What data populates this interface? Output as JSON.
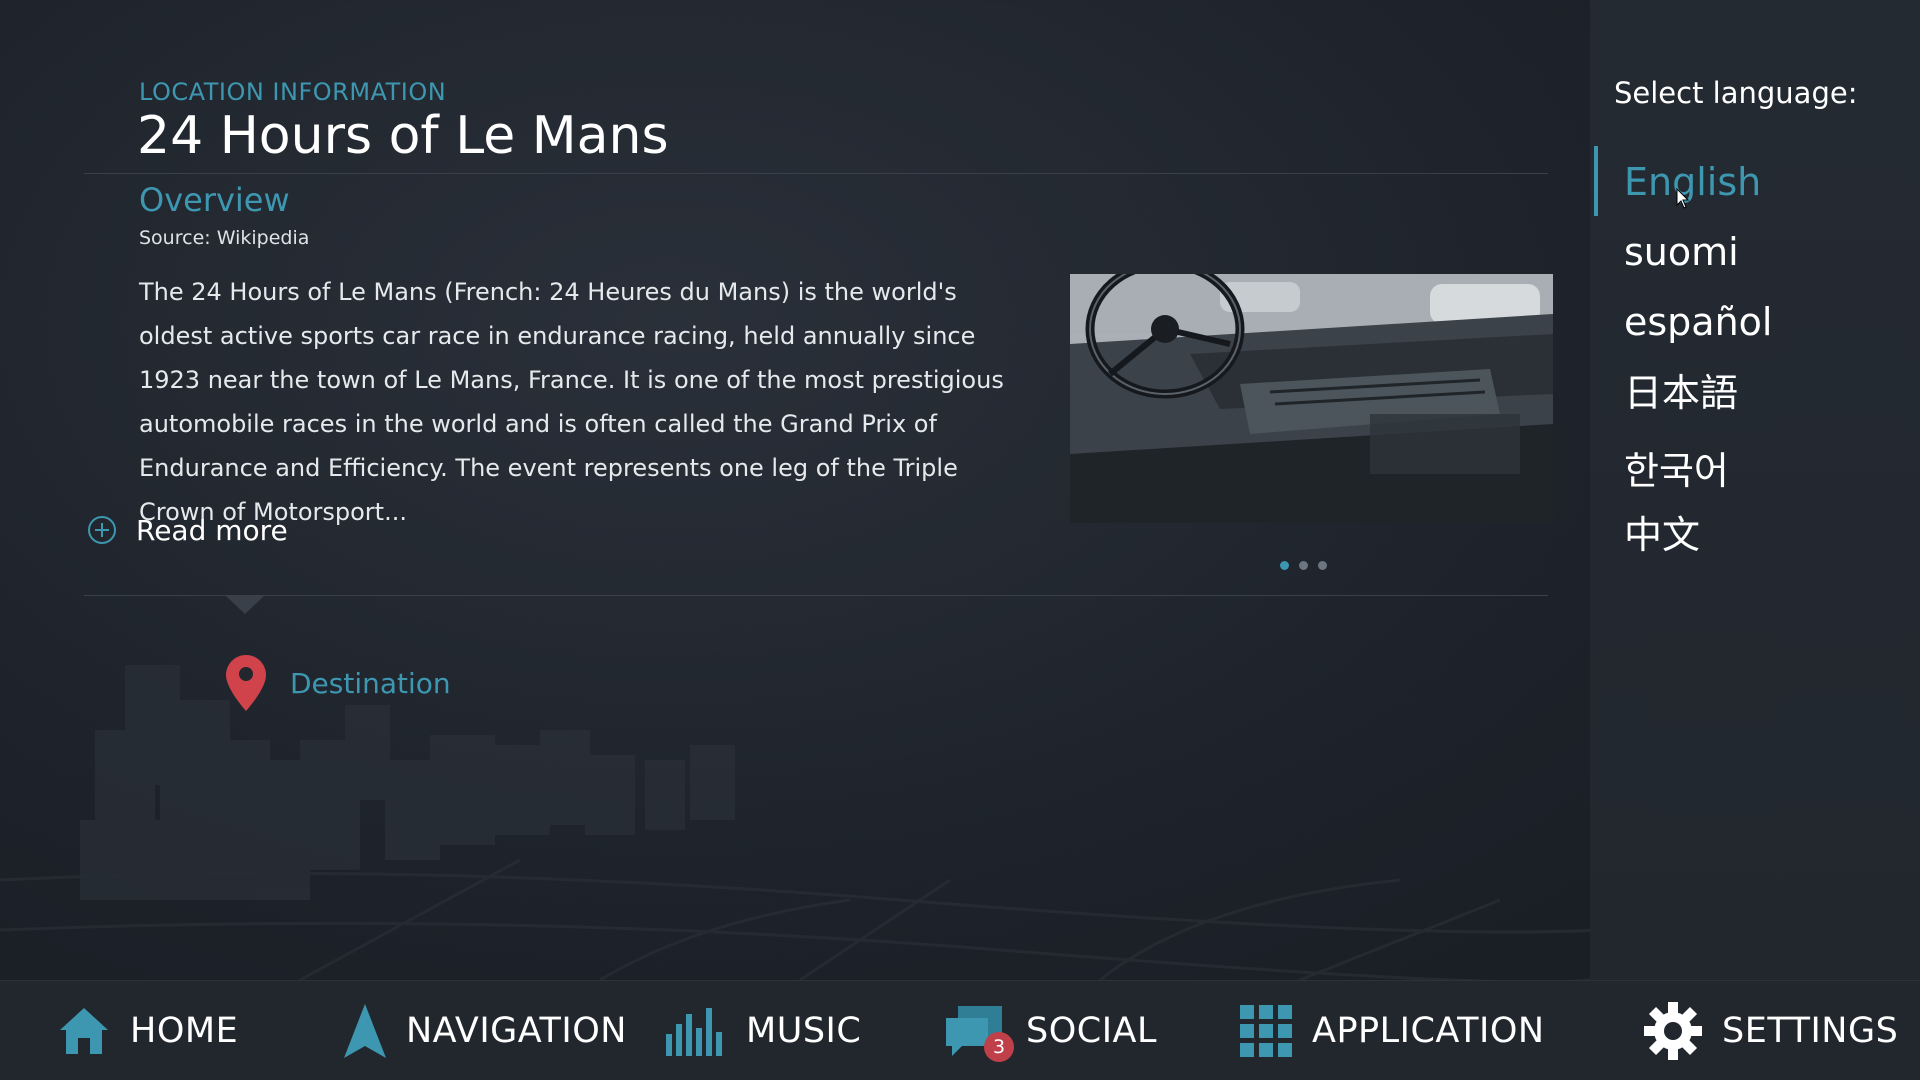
{
  "location": {
    "category": "LOCATION INFORMATION",
    "title": "24 Hours of Le Mans",
    "section": "Overview",
    "source": "Source: Wikipedia",
    "body": "The 24 Hours of Le Mans (French: 24 Heures du Mans) is the world's oldest active sports car race in endurance racing, held annually since 1923 near the town of Le Mans, France. It is one of the most prestigious automobile races in the world and is often called the Grand Prix of Endurance and Efficiency. The event represents one leg of the Triple Crown of Motorsport...",
    "read_more": "Read more",
    "destination": "Destination",
    "image_pager": {
      "count": 3,
      "active_index": 0
    }
  },
  "language": {
    "title": "Select language:",
    "selected": "English",
    "options": [
      "English",
      "suomi",
      "español",
      "日本語",
      "한국어",
      "中文"
    ]
  },
  "nav": {
    "items": [
      {
        "label": "HOME",
        "icon": "home-icon"
      },
      {
        "label": "NAVIGATION",
        "icon": "navigation-arrow-icon"
      },
      {
        "label": "MUSIC",
        "icon": "equalizer-icon"
      },
      {
        "label": "SOCIAL",
        "icon": "chat-bubbles-icon",
        "badge": "3"
      },
      {
        "label": "APPLICATION",
        "icon": "app-grid-icon"
      },
      {
        "label": "SETTINGS",
        "icon": "gear-icon"
      }
    ]
  },
  "colors": {
    "accent": "#3d97b0",
    "background": "#1d222a",
    "panel": "#22272e",
    "badge": "#c0404a",
    "pin": "#d1434b"
  }
}
